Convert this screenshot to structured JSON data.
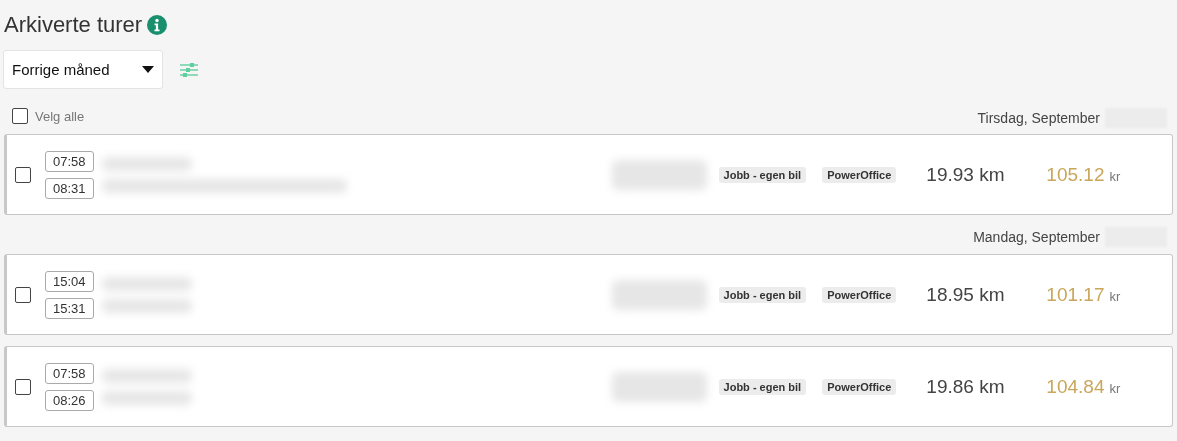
{
  "title": "Arkiverte turer",
  "period_select": {
    "value": "Forrige måned"
  },
  "select_all": {
    "label": "Velg alle",
    "checked": false
  },
  "days": [
    {
      "date": "Tirsdag, September",
      "trips": [
        {
          "checked": false,
          "start": "07:58",
          "end": "08:31",
          "tags": [
            "Jobb - egen bil",
            "PowerOffice"
          ],
          "distance": "19.93 km",
          "amount": "105.12",
          "currency": "kr"
        }
      ]
    },
    {
      "date": "Mandag, September",
      "trips": [
        {
          "checked": false,
          "start": "15:04",
          "end": "15:31",
          "tags": [
            "Jobb - egen bil",
            "PowerOffice"
          ],
          "distance": "18.95 km",
          "amount": "101.17",
          "currency": "kr"
        },
        {
          "checked": false,
          "start": "07:58",
          "end": "08:26",
          "tags": [
            "Jobb - egen bil",
            "PowerOffice"
          ],
          "distance": "19.86 km",
          "amount": "104.84",
          "currency": "kr"
        }
      ]
    }
  ]
}
